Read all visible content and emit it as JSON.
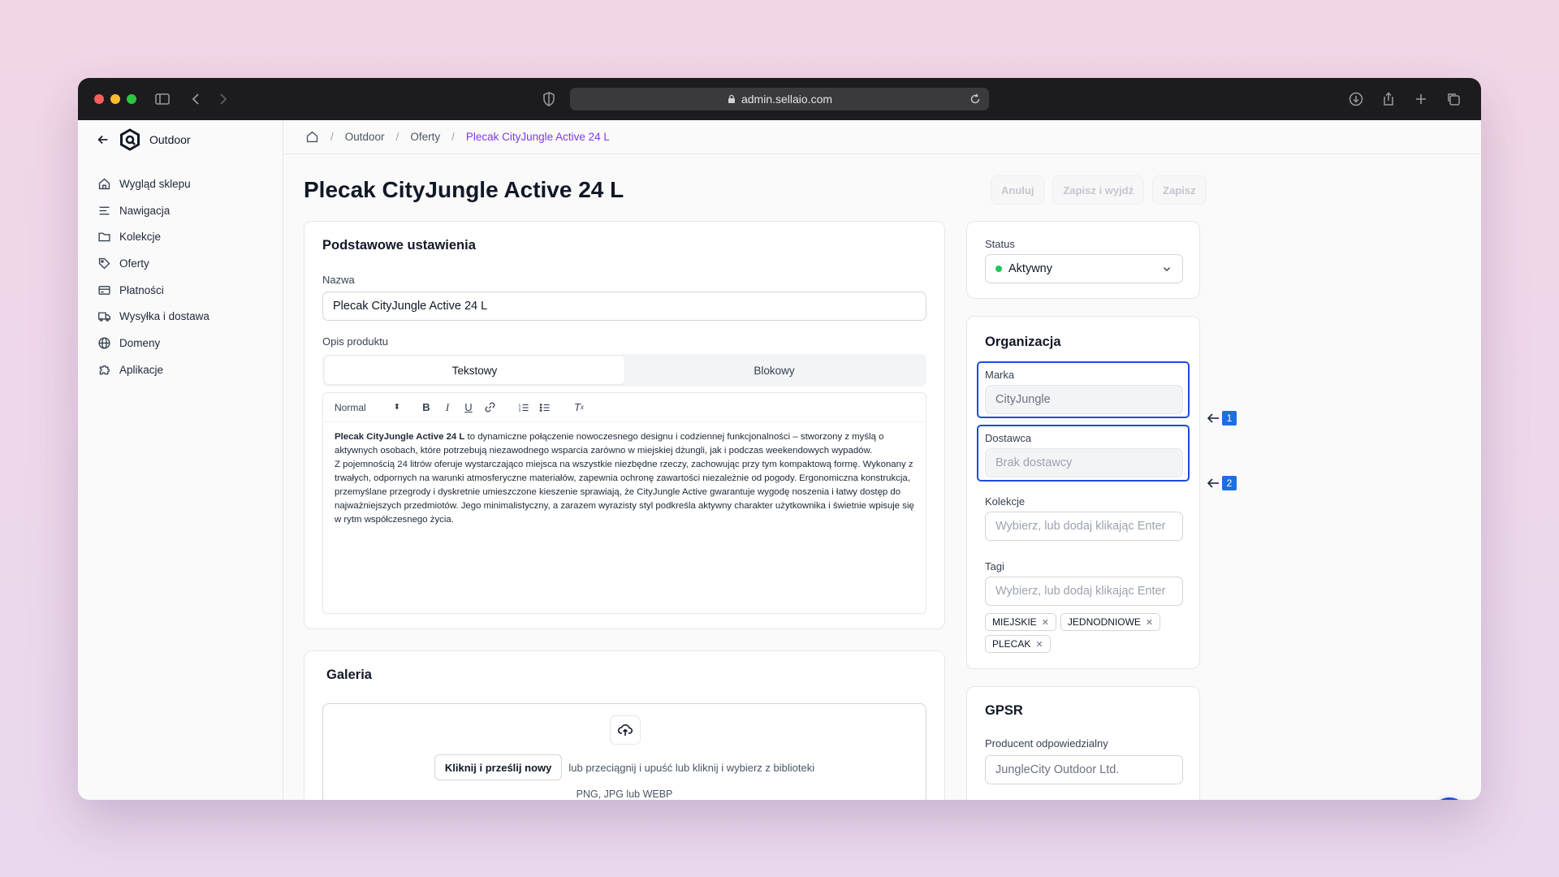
{
  "browser": {
    "url": "admin.sellaio.com",
    "traffic_colors": [
      "#ff5f57",
      "#febc2e",
      "#28c840"
    ]
  },
  "sidebar": {
    "store_name": "Outdoor",
    "items": [
      {
        "label": "Wygląd sklepu",
        "icon": "home-icon"
      },
      {
        "label": "Nawigacja",
        "icon": "menu-lines-icon"
      },
      {
        "label": "Kolekcje",
        "icon": "folder-icon"
      },
      {
        "label": "Oferty",
        "icon": "tag-icon"
      },
      {
        "label": "Płatności",
        "icon": "credit-card-icon"
      },
      {
        "label": "Wysyłka i dostawa",
        "icon": "truck-icon"
      },
      {
        "label": "Domeny",
        "icon": "globe-icon"
      },
      {
        "label": "Aplikacje",
        "icon": "puzzle-icon"
      }
    ]
  },
  "breadcrumb": {
    "items": [
      "Outdoor",
      "Oferty"
    ],
    "current": "Plecak CityJungle Active 24 L"
  },
  "page": {
    "title": "Plecak CityJungle Active 24 L"
  },
  "actions": {
    "cancel": "Anuluj",
    "save_exit": "Zapisz i wyjdź",
    "save": "Zapisz"
  },
  "basic": {
    "title": "Podstawowe ustawienia",
    "name_label": "Nazwa",
    "name_value": "Plecak CityJungle Active 24 L",
    "desc_label": "Opis produktu",
    "tab_text": "Tekstowy",
    "tab_block": "Blokowy",
    "format_select": "Normal",
    "desc_bold": "Plecak CityJungle Active 24 L",
    "desc_rest": " to dynamiczne połączenie nowoczesnego designu i codziennej funkcjonalności – stworzony z myślą o aktywnych osobach, które potrzebują niezawodnego wsparcia zarówno w miejskiej dżungli, jak i podczas weekendowych wypadów.",
    "desc_p2": "Z pojemnością 24 litrów oferuje wystarczająco miejsca na wszystkie niezbędne rzeczy, zachowując przy tym kompaktową formę. Wykonany z trwałych, odpornych na warunki atmosferyczne materiałów, zapewnia ochronę zawartości niezależnie od pogody. Ergonomiczna konstrukcja, przemyślane przegrody i dyskretnie umieszczone kieszenie sprawiają, że CityJungle Active gwarantuje wygodę noszenia i łatwy dostęp do najważniejszych przedmiotów. Jego minimalistyczny, a zarazem wyrazisty styl podkreśla aktywny charakter użytkownika i świetnie wpisuje się w rytm współczesnego życia."
  },
  "gallery": {
    "title": "Galeria",
    "upload_button": "Kliknij i prześlij nowy",
    "upload_hint": "lub przeciągnij i upuść lub kliknij i wybierz z biblioteki",
    "formats": "PNG, JPG lub WEBP"
  },
  "status": {
    "label": "Status",
    "value": "Aktywny",
    "color": "#22c55e"
  },
  "organization": {
    "title": "Organizacja",
    "brand_label": "Marka",
    "brand_value": "CityJungle",
    "supplier_label": "Dostawca",
    "supplier_placeholder": "Brak dostawcy",
    "collections_label": "Kolekcje",
    "collections_placeholder": "Wybierz, lub dodaj klikając Enter",
    "tags_label": "Tagi",
    "tags_placeholder": "Wybierz, lub dodaj klikając Enter",
    "tags": [
      "MIEJSKIE",
      "JEDNODNIOWE",
      "PLECAK"
    ],
    "callouts": [
      "1",
      "2"
    ]
  },
  "gpsr": {
    "title": "GPSR",
    "producer_label": "Producent odpowiedzialny",
    "producer_value": "JungleCity Outdoor Ltd."
  }
}
